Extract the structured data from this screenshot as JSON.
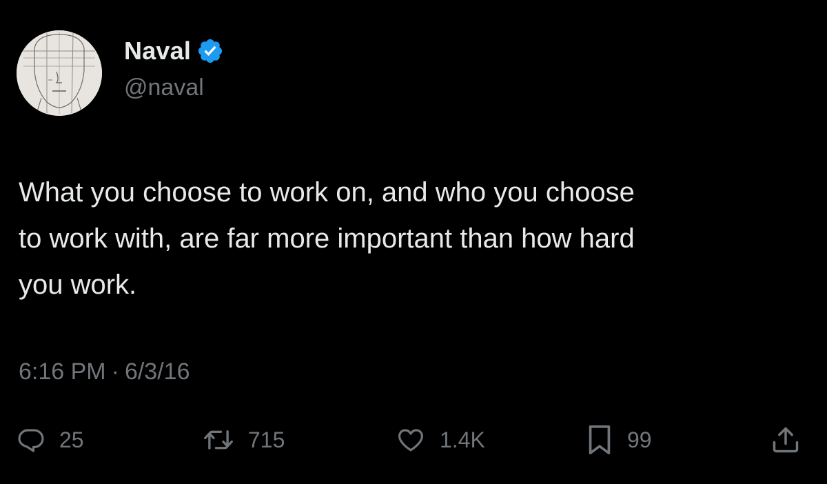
{
  "author": {
    "display_name": "Naval",
    "handle": "@naval",
    "verified": true,
    "verified_color": "#1d9bf0"
  },
  "tweet": {
    "text": "What you choose to work on, and who you choose\nto work with, are far more important than how hard\nyou work.",
    "time": "6:16 PM",
    "separator": "·",
    "date": "6/3/16"
  },
  "actions": {
    "reply": {
      "icon": "reply-icon",
      "count": "25"
    },
    "retweet": {
      "icon": "retweet-icon",
      "count": "715"
    },
    "like": {
      "icon": "heart-icon",
      "count": "1.4K"
    },
    "bookmark": {
      "icon": "bookmark-icon",
      "count": "99"
    },
    "share": {
      "icon": "share-icon"
    }
  },
  "colors": {
    "background": "#000000",
    "primary_text": "#e7e9ea",
    "secondary_text": "#71767b"
  }
}
